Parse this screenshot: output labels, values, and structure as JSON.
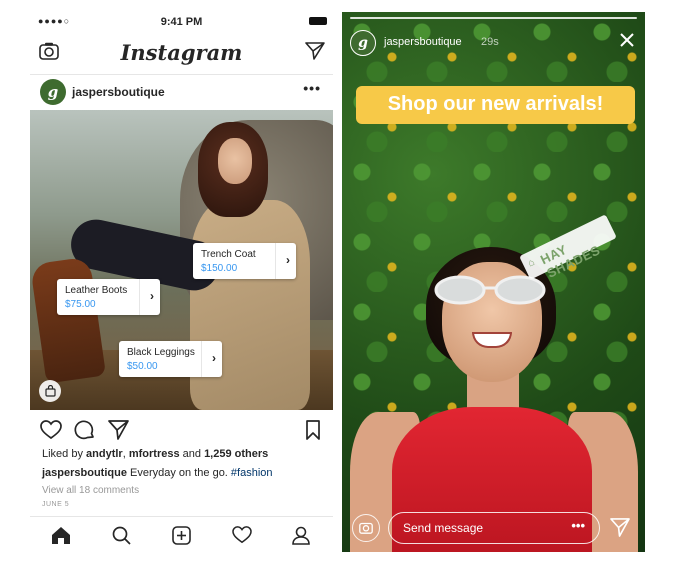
{
  "feed": {
    "status": {
      "signal": "●●●●○",
      "time": "9:41 PM"
    },
    "header": {
      "logo": "Instagram"
    },
    "post": {
      "avatar_letter": "g",
      "username": "jaspersboutique",
      "more": "•••",
      "tags": [
        {
          "name": "Trench Coat",
          "price": "$150.00"
        },
        {
          "name": "Leather Boots",
          "price": "$75.00"
        },
        {
          "name": "Black Leggings",
          "price": "$50.00"
        }
      ],
      "likes_prefix": "Liked by ",
      "likes_user1": "andytlr",
      "likes_sep": ", ",
      "likes_user2": "mfortress",
      "likes_and": " and ",
      "likes_others": "1,259 others",
      "caption_user": "jaspersboutique",
      "caption_text": " Everyday on the go. ",
      "caption_hashtag": "#fashion",
      "comments_link": "View all 18 comments",
      "date": "JUNE 5"
    },
    "colors": {
      "link_blue": "#3897f0",
      "avatar_green": "#3e6b2f"
    }
  },
  "story": {
    "avatar_letter": "g",
    "username": "jaspersboutique",
    "time": "29s",
    "banner": "Shop our new arrivals!",
    "sticker": "HAY SHADES",
    "message_placeholder": "Send message",
    "more": "•••",
    "colors": {
      "banner": "#f7c948",
      "top": "#e22632"
    }
  }
}
